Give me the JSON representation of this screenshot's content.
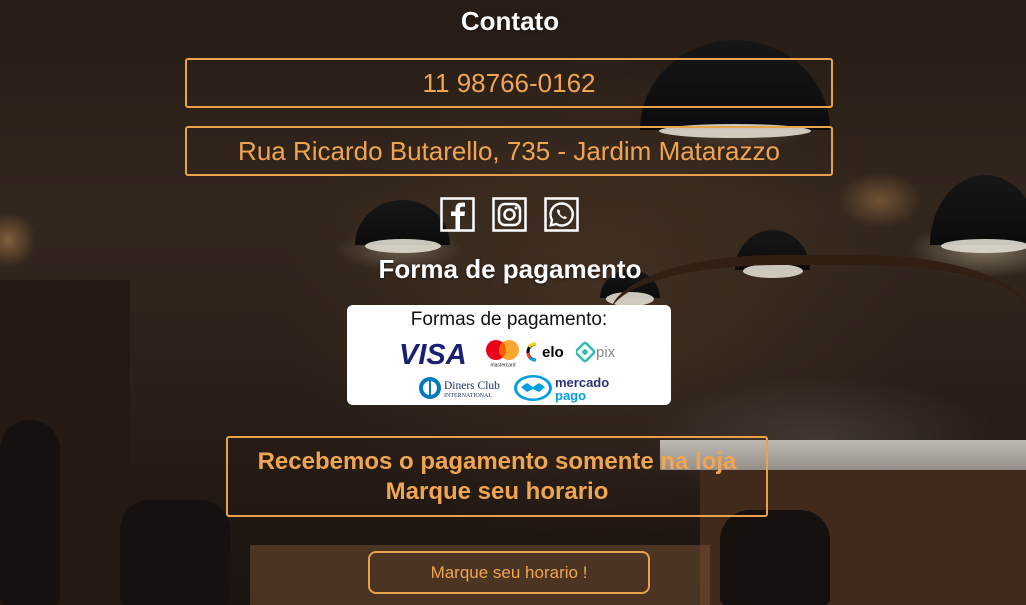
{
  "contact": {
    "title": "Contato",
    "phone": "11 98766-0162",
    "address": "Rua Ricardo Butarello, 735 - Jardim Matarazzo"
  },
  "social": {
    "icons": [
      "facebook-icon",
      "instagram-icon",
      "whatsapp-icon"
    ]
  },
  "payment": {
    "title": "Forma de pagamento",
    "card_title": "Formas de pagamento:",
    "brands": {
      "visa": "VISA",
      "mastercard": "mastercard",
      "elo": "elo",
      "pix": "pix",
      "diners_line1": "Diners Club",
      "diners_line2": "INTERNATIONAL",
      "mercado_line1": "mercado",
      "mercado_line2": "pago"
    },
    "notice": "Recebemos o pagamento somente na loja Marque seu horario"
  },
  "cta": {
    "label": "Marque seu horario !"
  },
  "colors": {
    "accent": "#e9a24b",
    "text_accent": "#f0a552",
    "heading": "#ffffff"
  }
}
